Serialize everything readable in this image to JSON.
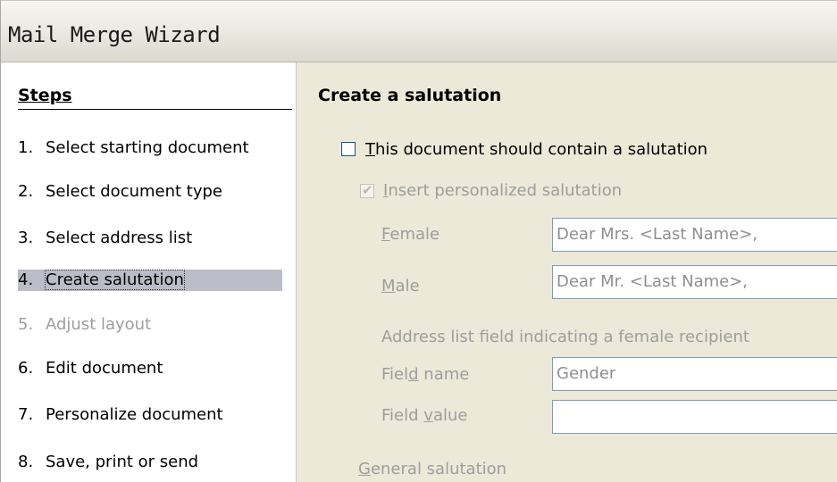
{
  "window": {
    "title": "Mail Merge Wizard"
  },
  "steps": {
    "title": "Steps",
    "items": [
      {
        "num": "1.",
        "label": "Select starting document",
        "state": "normal"
      },
      {
        "num": "2.",
        "label": "Select document type",
        "state": "normal"
      },
      {
        "num": "3.",
        "label": "Select address list",
        "state": "normal"
      },
      {
        "num": "4.",
        "label": "Create salutation",
        "state": "active"
      },
      {
        "num": "5.",
        "label": "Adjust layout",
        "state": "disabled"
      },
      {
        "num": "6.",
        "label": "Edit document",
        "state": "normal"
      },
      {
        "num": "7.",
        "label": "Personalize document",
        "state": "normal"
      },
      {
        "num": "8.",
        "label": "Save, print or send",
        "state": "normal"
      }
    ]
  },
  "content": {
    "heading": "Create a salutation",
    "contain_salutation": {
      "mnemonic": "T",
      "label_rest": "his document should contain a salutation",
      "checked": false
    },
    "insert_personalized": {
      "mnemonic": "I",
      "label_rest": "nsert personalized salutation",
      "checked": true
    },
    "female": {
      "mnemonic": "F",
      "label_rest": "emale",
      "value": "Dear Mrs. <Last Name>,"
    },
    "male": {
      "mnemonic": "M",
      "label_rest": "ale",
      "value": "Dear Mr. <Last Name>,"
    },
    "address_field_caption": "Address list field indicating a female recipient",
    "field_name": {
      "pre": "Fiel",
      "mnemonic": "d",
      "post": " name",
      "value": "Gender"
    },
    "field_value": {
      "pre": "Field ",
      "mnemonic": "v",
      "post": "alue",
      "value": ""
    },
    "general_salutation": {
      "mnemonic": "G",
      "label_rest": "eneral salutation"
    }
  }
}
